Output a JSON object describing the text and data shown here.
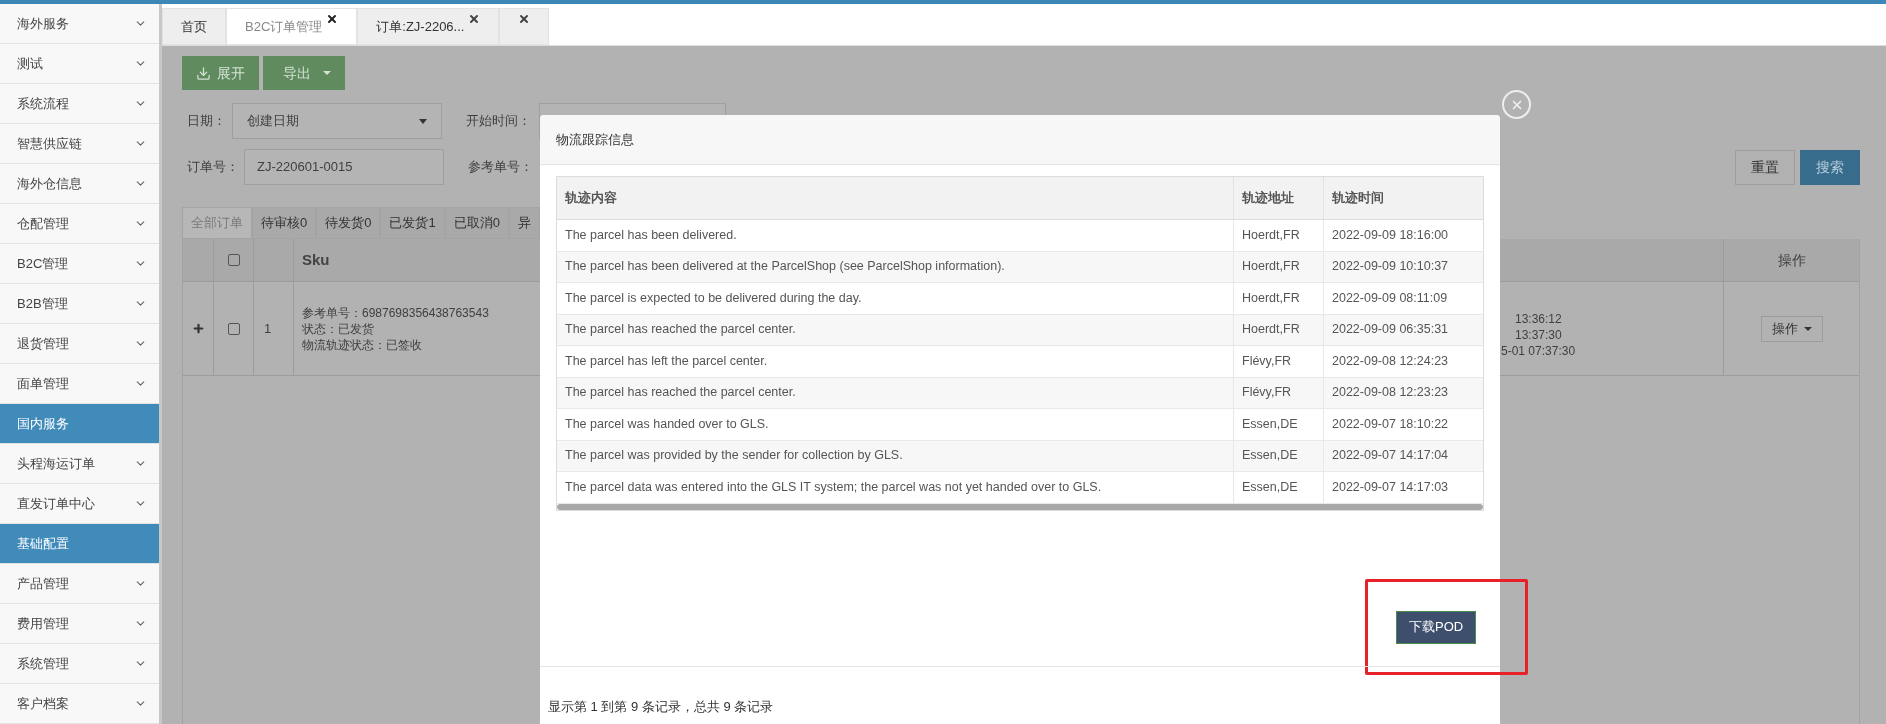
{
  "sidebar": {
    "items": [
      {
        "label": "海外服务",
        "selected": false
      },
      {
        "label": "测试",
        "selected": false
      },
      {
        "label": "系统流程",
        "selected": false
      },
      {
        "label": "智慧供应链",
        "selected": false
      },
      {
        "label": "海外仓信息",
        "selected": false
      },
      {
        "label": "仓配管理",
        "selected": false
      },
      {
        "label": "B2C管理",
        "selected": false
      },
      {
        "label": "B2B管理",
        "selected": false
      },
      {
        "label": "退货管理",
        "selected": false
      },
      {
        "label": "面单管理",
        "selected": false
      },
      {
        "label": "国内服务",
        "selected": true
      },
      {
        "label": "头程海运订单",
        "selected": false
      },
      {
        "label": "直发订单中心",
        "selected": false
      },
      {
        "label": "基础配置",
        "selected": true
      },
      {
        "label": "产品管理",
        "selected": false
      },
      {
        "label": "费用管理",
        "selected": false
      },
      {
        "label": "系统管理",
        "selected": false
      },
      {
        "label": "客户档案",
        "selected": false
      }
    ]
  },
  "tabs": [
    {
      "label": "首页",
      "selected": false,
      "closable": false
    },
    {
      "label": "B2C订单管理",
      "selected": true,
      "closable": true
    },
    {
      "label": "订单:ZJ-2206...",
      "selected": false,
      "closable": true
    },
    {
      "selected": false,
      "closable": true
    }
  ],
  "toolbar": {
    "buttons": [
      {
        "label": "展开",
        "kind": "expand"
      },
      {
        "label": "导出",
        "kind": "dropdown"
      }
    ]
  },
  "filters": {
    "date_label": "日期：",
    "date_select": "创建日期",
    "start_label": "开始时间：",
    "order_no_label": "订单号：",
    "order_no_value": "ZJ-220601-0015",
    "ref_no_label": "参考单号：",
    "reset": "重置",
    "search": "搜索"
  },
  "status_tabs": [
    {
      "label": "全部订单",
      "selected": true
    },
    {
      "label": "待审核0",
      "selected": false
    },
    {
      "label": "待发货0",
      "selected": false
    },
    {
      "label": "已发货1",
      "selected": false
    },
    {
      "label": "已取消0",
      "selected": false
    },
    {
      "label": "异",
      "selected": false
    }
  ],
  "order_table": {
    "header_checked": false,
    "sku_header": "Sku",
    "action_header": "操作",
    "rows": [
      {
        "index": "1",
        "checked": false,
        "details": [
          "参考单号：6987698356438763543",
          "状态：已发货",
          "物流轨迹状态：已签收"
        ],
        "times": [
          "13:36:12",
          "13:37:30",
          "5-01 07:37:30"
        ],
        "action": "操作"
      }
    ]
  },
  "modal": {
    "title": "物流跟踪信息",
    "columns": [
      "轨迹内容",
      "轨迹地址",
      "轨迹时间"
    ],
    "rows": [
      {
        "content": "The parcel has been delivered.",
        "address": "Hoerdt,FR",
        "time": "2022-09-09 18:16:00"
      },
      {
        "content": "The parcel has been delivered at the ParcelShop (see ParcelShop information).",
        "address": "Hoerdt,FR",
        "time": "2022-09-09 10:10:37"
      },
      {
        "content": "The parcel is expected to be delivered during the day.",
        "address": "Hoerdt,FR",
        "time": "2022-09-09 08:11:09"
      },
      {
        "content": "The parcel has reached the parcel center.",
        "address": "Hoerdt,FR",
        "time": "2022-09-09 06:35:31"
      },
      {
        "content": "The parcel has left the parcel center.",
        "address": "Flévy,FR",
        "time": "2022-09-08 12:24:23"
      },
      {
        "content": "The parcel has reached the parcel center.",
        "address": "Flévy,FR",
        "time": "2022-09-08 12:23:23"
      },
      {
        "content": "The parcel was handed over to GLS.",
        "address": "Essen,DE",
        "time": "2022-09-07 18:10:22"
      },
      {
        "content": "The parcel was provided by the sender for collection by GLS.",
        "address": "Essen,DE",
        "time": "2022-09-07 14:17:04"
      },
      {
        "content": "The parcel data was entered into the GLS IT system; the parcel was not yet handed over to GLS.",
        "address": "Essen,DE",
        "time": "2022-09-07 14:17:03"
      }
    ],
    "button": "下载POD",
    "footer": "显示第 1 到第 9 条记录，总共 9 条记录"
  }
}
